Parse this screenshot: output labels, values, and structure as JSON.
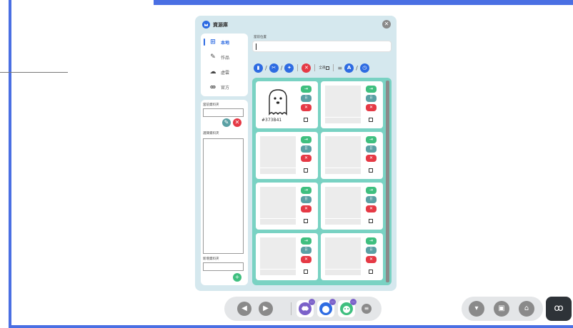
{
  "panel": {
    "title": "資源庫",
    "close_icon": "close-icon",
    "location_label": "當前位置",
    "location_value": ""
  },
  "nav": {
    "items": [
      {
        "label": "本地",
        "icon": "windows-icon",
        "active": true
      },
      {
        "label": "作品",
        "icon": "brush-icon",
        "active": false
      },
      {
        "label": "虛雲",
        "icon": "cloud-icon",
        "active": false
      },
      {
        "label": "官方",
        "icon": "owl-icon",
        "active": false
      }
    ]
  },
  "folder_panel": {
    "current_folder_label": "當前資料夾",
    "select_folder_label": "選擇資料夾",
    "new_folder_label": "新增資料夾"
  },
  "toolbar": {
    "select_all_label": "全選",
    "filter_icons": [
      "clipboard-icon",
      "scissors-icon",
      "paste-icon"
    ],
    "sort_icons": [
      "lines-icon",
      "alpha-icon",
      "clock-icon"
    ]
  },
  "cards": [
    {
      "name": "#373B41",
      "has_ghost": true
    },
    {
      "name": "",
      "has_ghost": false
    },
    {
      "name": "",
      "has_ghost": false
    },
    {
      "name": "",
      "has_ghost": false
    },
    {
      "name": "",
      "has_ghost": false
    },
    {
      "name": "",
      "has_ghost": false
    },
    {
      "name": "",
      "has_ghost": false
    },
    {
      "name": "",
      "has_ghost": false
    }
  ],
  "colors": {
    "frame_blue": "#4a6fe3",
    "panel_bg": "#d5e8ee",
    "grid_teal": "#79d2c3",
    "green": "#3fbf7f",
    "teal_grey": "#5aa0a4",
    "red": "#e53945",
    "blue": "#2d6be2",
    "grey": "#8a8a8a"
  }
}
